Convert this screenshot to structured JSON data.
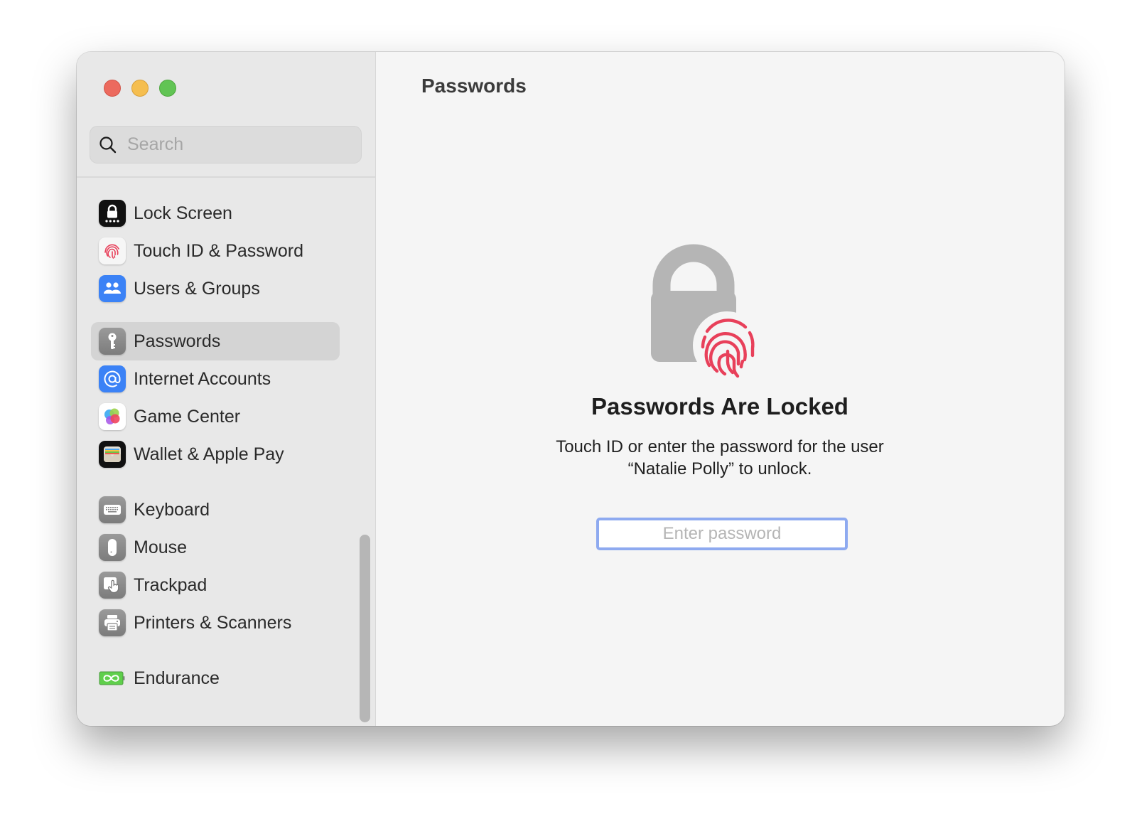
{
  "window": {
    "traffic_lights": {
      "close": "#ec6a5e",
      "minimize": "#f5be4f",
      "maximize": "#61c454"
    }
  },
  "sidebar": {
    "search": {
      "placeholder": "Search",
      "value": "",
      "icon": "search-icon"
    },
    "groups": [
      [
        {
          "label": "Lock Screen",
          "icon": "lock-screen-icon",
          "selected": false
        },
        {
          "label": "Touch ID & Password",
          "icon": "fingerprint-icon",
          "selected": false
        },
        {
          "label": "Users & Groups",
          "icon": "users-icon",
          "selected": false
        }
      ],
      [
        {
          "label": "Passwords",
          "icon": "key-icon",
          "selected": true
        },
        {
          "label": "Internet Accounts",
          "icon": "at-sign-icon",
          "selected": false
        },
        {
          "label": "Game Center",
          "icon": "game-center-icon",
          "selected": false
        },
        {
          "label": "Wallet & Apple Pay",
          "icon": "wallet-icon",
          "selected": false
        }
      ],
      [
        {
          "label": "Keyboard",
          "icon": "keyboard-icon",
          "selected": false
        },
        {
          "label": "Mouse",
          "icon": "mouse-icon",
          "selected": false
        },
        {
          "label": "Trackpad",
          "icon": "trackpad-icon",
          "selected": false
        },
        {
          "label": "Printers & Scanners",
          "icon": "printer-icon",
          "selected": false
        }
      ],
      [
        {
          "label": "Endurance",
          "icon": "endurance-battery-icon",
          "selected": false
        }
      ]
    ]
  },
  "main": {
    "title": "Passwords",
    "locked": {
      "icon": "lock-with-fingerprint-icon",
      "heading": "Passwords Are Locked",
      "description_line1": "Touch ID or enter the password for the user",
      "description_line2": "“Natalie Polly” to unlock.",
      "password_field": {
        "placeholder": "Enter password",
        "value": ""
      },
      "accent": "#8eaaf0",
      "fingerprint_color": "#e8405a"
    }
  }
}
